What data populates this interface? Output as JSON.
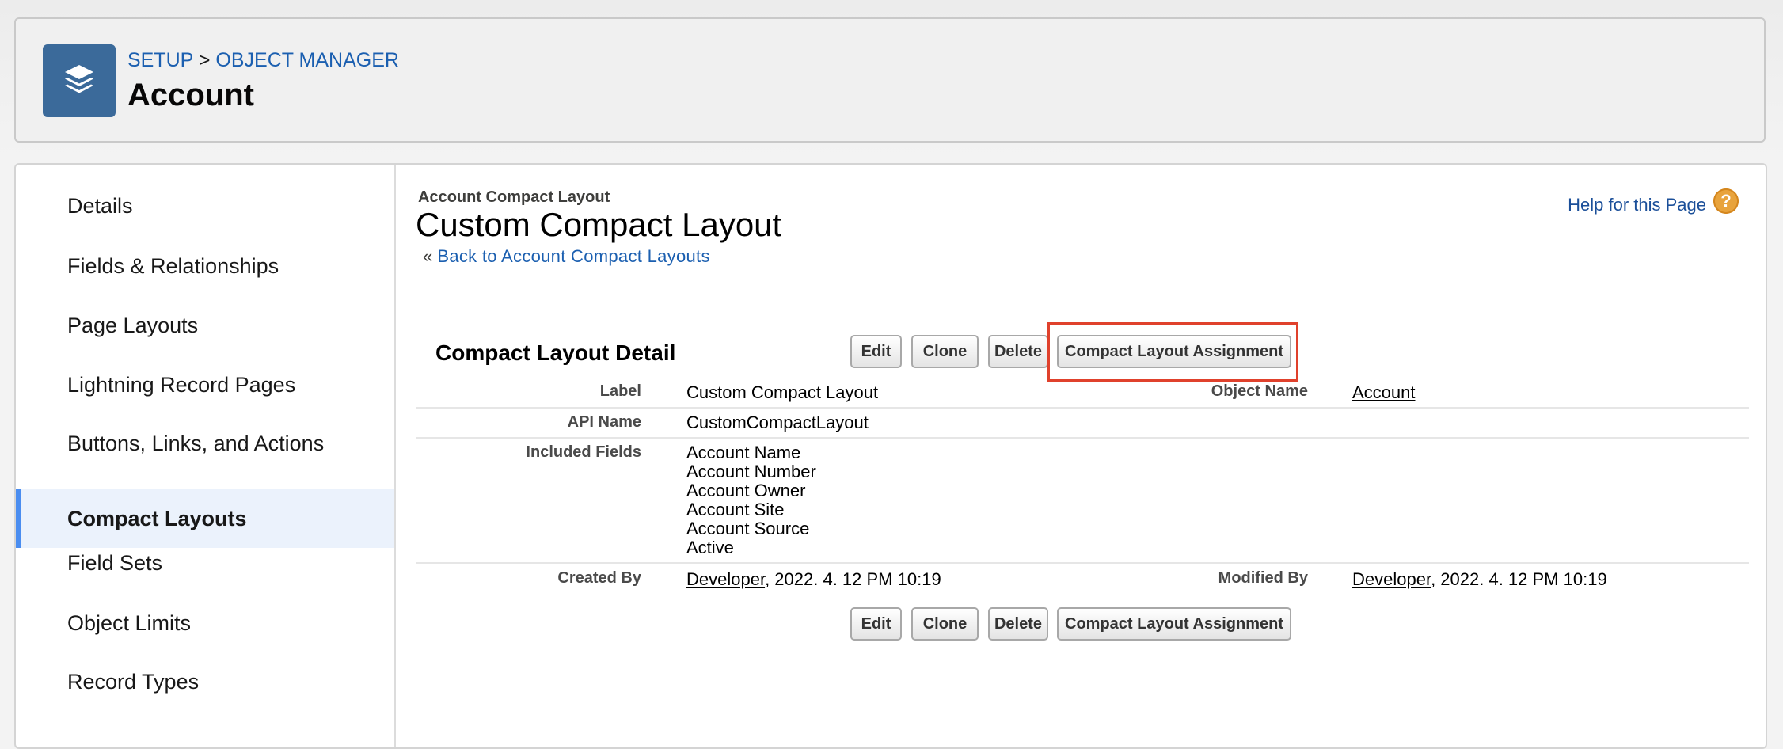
{
  "header": {
    "breadcrumb_setup": "SETUP",
    "breadcrumb_sep": ">",
    "breadcrumb_manager": "OBJECT MANAGER",
    "title": "Account",
    "icon": "layers-icon"
  },
  "sidebar": {
    "items": [
      {
        "label": "Details"
      },
      {
        "label": "Fields & Relationships"
      },
      {
        "label": "Page Layouts"
      },
      {
        "label": "Lightning Record Pages"
      },
      {
        "label": "Buttons, Links, and Actions"
      },
      {
        "label": "Compact Layouts",
        "active": true
      },
      {
        "label": "Field Sets"
      },
      {
        "label": "Object Limits"
      },
      {
        "label": "Record Types"
      }
    ]
  },
  "content": {
    "small_title": "Account Compact Layout",
    "title": "Custom Compact Layout",
    "back_prefix": "«",
    "back_link": "Back to Account Compact Layouts",
    "help_link": "Help for this Page",
    "help_icon": "?",
    "section_title": "Compact Layout Detail",
    "buttons": {
      "edit": "Edit",
      "clone": "Clone",
      "delete": "Delete",
      "assignment": "Compact Layout Assignment"
    },
    "detail": {
      "label_label": "Label",
      "label_value": "Custom Compact Layout",
      "object_name_label": "Object Name",
      "object_name_value": "Account",
      "api_name_label": "API Name",
      "api_name_value": "CustomCompactLayout",
      "included_fields_label": "Included Fields",
      "included_fields": [
        "Account Name",
        "Account Number",
        "Account Owner",
        "Account Site",
        "Account Source",
        "Active"
      ],
      "created_by_label": "Created By",
      "created_by_user": "Developer",
      "created_by_date": ", 2022. 4. 12 PM 10:19",
      "modified_by_label": "Modified By",
      "modified_by_user": "Developer",
      "modified_by_date": ", 2022. 4. 12 PM 10:19"
    }
  },
  "colors": {
    "accent": "#4a8df0",
    "link": "#1b5fb0",
    "highlight_box": "#e0412c",
    "icon_bg": "#3b6a9a"
  }
}
